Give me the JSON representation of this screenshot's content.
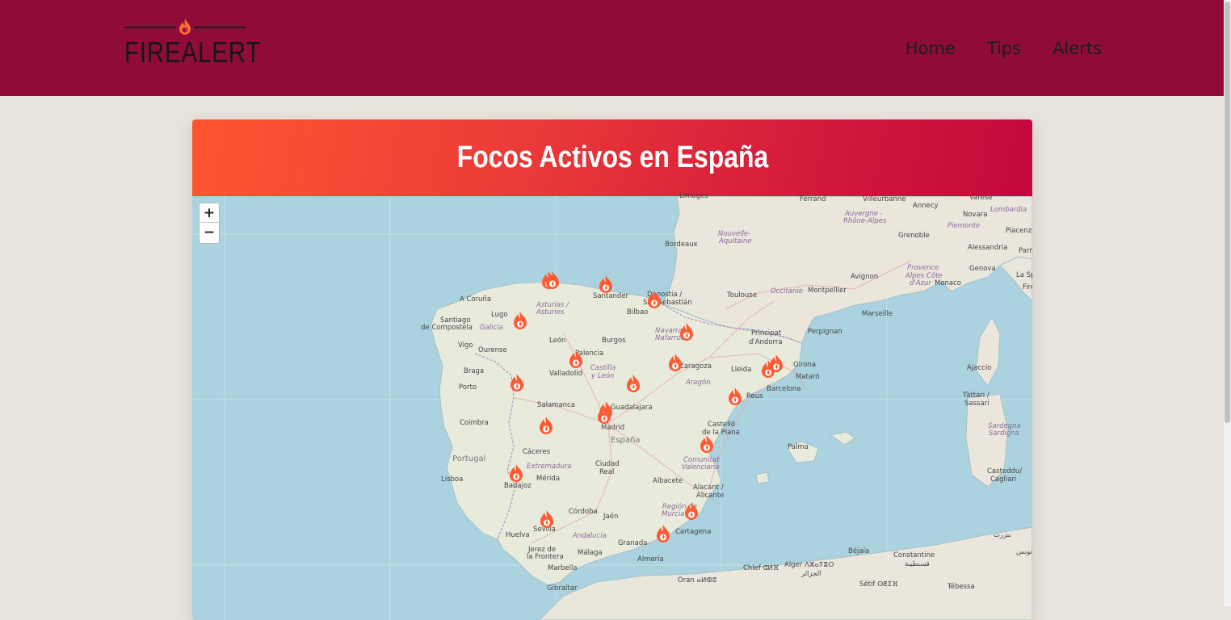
{
  "nav": {
    "logo_text": "FIREALERT",
    "links": [
      "Home",
      "Tips",
      "Alerts"
    ]
  },
  "card": {
    "title": "Focos Activos en España"
  },
  "map": {
    "zoom_in_label": "+",
    "zoom_out_label": "−",
    "labels": {
      "limoges": "Limoges",
      "ferrand": "Ferrand",
      "villeurbanne": "Villeurbanne",
      "varese": "Varese",
      "annecy": "Annecy",
      "novara": "Novara",
      "lombardia": "Lombardia",
      "auvergne": "Auvergne -",
      "rhone_alpes": "Rhône-Alpes",
      "piacenza": "Piacenza",
      "bordeaux": "Bordeaux",
      "grenoble": "Grenoble",
      "alessandria": "Alessandria",
      "nouvelle": "Nouvelle-",
      "aquitaine": "Aquitaine",
      "piemonte": "Piemonte",
      "parma": "Parma",
      "provence": "Provence",
      "alpes_cote": "Alpes Côte",
      "dazur": "d'Azur",
      "genova": "Genova",
      "la_spe": "La Spe",
      "toulouse": "Toulouse",
      "montpellier": "Montpellier",
      "avignon": "Avignon",
      "monaco": "Monaco",
      "occitanie": "Occitanie",
      "marseille": "Marseille",
      "donostia": "Donostia /",
      "san_sebastian": "San Sebastián",
      "santander": "Santander",
      "bilbao": "Bilbao",
      "asturias": "Asturias /",
      "asturies": "Asturies",
      "a_coruna": "A Coruña",
      "lugo": "Lugo",
      "santiago": "Santiago",
      "de_compostela": "de Compostela",
      "galicia": "Galicia",
      "vigo": "Vigo",
      "ourense": "Ourense",
      "leon": "León",
      "burgos": "Burgos",
      "navarra": "Navarra -",
      "nafarroa": "Nafarroa",
      "principat": "Principat",
      "dandorra": "d'Andorra",
      "perpignan": "Perpignan",
      "palencia": "Palencia",
      "braga": "Braga",
      "castilla": "Castilla",
      "y_leon": "y León",
      "valladolid": "Valladolid",
      "zaragoza": "Zaragoza",
      "lleida": "Lleida",
      "girona": "Girona",
      "aragon": "Aragón",
      "mataro": "Mataró",
      "porto": "Porto",
      "barcelona": "Barcelona",
      "reus": "Reus",
      "salamanca": "Salamanca",
      "guadalajara": "Guadalajara",
      "coimbra": "Coimbra",
      "madrid": "Madrid",
      "espana": "España",
      "castello": "Castelló",
      "de_la_plana": "de la Plana",
      "caceres": "Cáceres",
      "portugal": "Portugal",
      "palma": "Palma",
      "extremadura": "Extremadura",
      "comunitat": "Comunitat",
      "valenciana": "Valenciana",
      "ciudad": "Ciudad",
      "real": "Real",
      "lisboa": "Lisboa",
      "merida": "Mérida",
      "badajoz": "Badajoz",
      "albacete": "Albacete",
      "alacant": "Alacant /",
      "alicante": "Alicante",
      "cordoba": "Córdoba",
      "jaen": "Jaén",
      "region_de": "Región de",
      "murcia": "Murcia",
      "sevilla": "Sevilla",
      "cartagena": "Cartagena",
      "huelva": "Huelva",
      "andalucia": "Andalucía",
      "jerez": "Jerez de",
      "la_frontera": "la Frontera",
      "malaga": "Málaga",
      "granada": "Granada",
      "almeria": "Almería",
      "marbella": "Marbella",
      "gibraltar": "Gibraltar",
      "oran": "Oran ⴰⵍⵀⵓ",
      "chlef": "Chlef ⵛⵍⴼ",
      "alger": "Alger ⴷⵣⴰⵢⴻⵔ",
      "alger_ar": "الجزائر",
      "constantine": "Constantine",
      "constantine_ar": "قسنطينة",
      "setif": "Sétif ⵙⵟⵉⴼ",
      "bejaia": "Béjaïa",
      "tebessa": "Tébessa",
      "ajaccio": "Ajaccio",
      "sassari": "Sassari",
      "tattari": "Tàttari /",
      "sardegna": "Sardegna",
      "sardigna": "Sardigna",
      "casteddu": "Casteddu/",
      "cagliari": "Cagliari",
      "tunis_ar": "تونس",
      "bizerte_ar": "بنزرت",
      "firenze": "Fire"
    }
  },
  "colors": {
    "topbar": "#8f0c3a",
    "marker": "#fe5a33",
    "header_from": "#ff5530",
    "header_to": "#c4073c"
  },
  "icons": {
    "logo": "flame-icon",
    "marker": "fire-marker-icon"
  }
}
